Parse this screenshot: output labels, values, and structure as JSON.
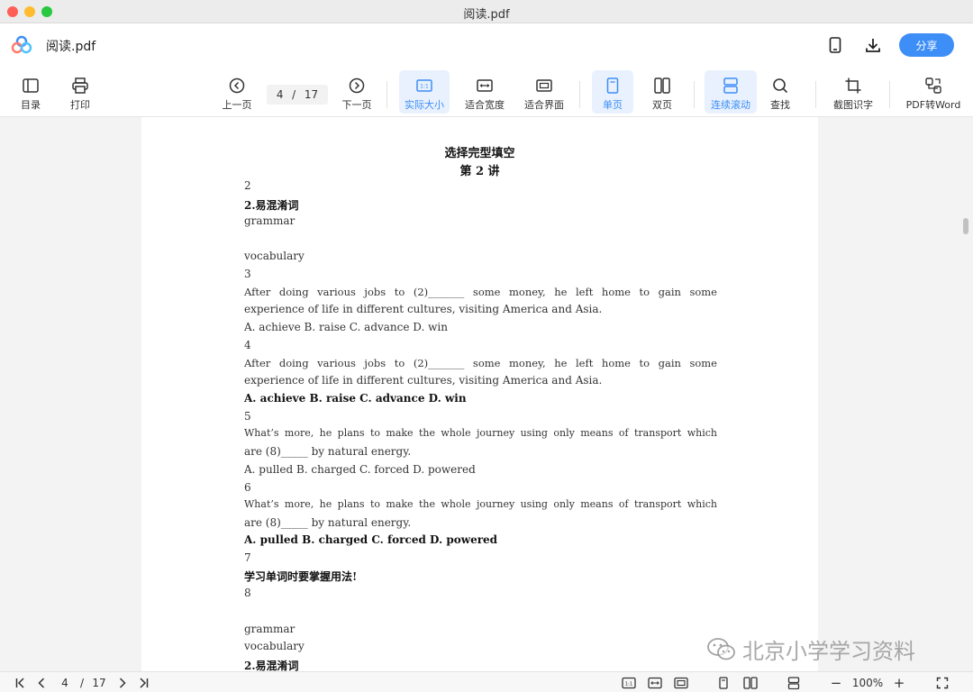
{
  "window": {
    "title": "阅读.pdf"
  },
  "header": {
    "doc_name": "阅读.pdf",
    "share_label": "分享"
  },
  "toolbar": {
    "toc": "目录",
    "print": "打印",
    "prev_page": "上一页",
    "current_page": "4",
    "page_sep": "/",
    "total_pages": "17",
    "next_page": "下一页",
    "actual_size": "实际大小",
    "fit_width": "适合宽度",
    "fit_screen": "适合界面",
    "single_page": "单页",
    "double_page": "双页",
    "continuous_scroll": "连续滚动",
    "find": "查找",
    "screenshot_ocr": "截图识字",
    "pdf_to_word": "PDF转Word"
  },
  "document": {
    "title_line1": "选择完型填空",
    "title_line2": "第 2 讲",
    "lines": [
      "2",
      "2.易混淆词",
      "grammar",
      "",
      "vocabulary",
      "3",
      "After doing various jobs to (2)_______ some money, he left home to gain some",
      "experience of life in different cultures, visiting America and Asia.",
      "A. achieve  B. raise  C. advance  D. win",
      "4",
      "After doing various jobs to (2)_______ some money, he left home to gain some",
      "experience of life in different cultures, visiting America and Asia.",
      "A. achieve  B. raise  C. advance  D. win",
      "5",
      "What’s more, he plans to make the whole journey using only means of transport which",
      "are (8)_____ by natural energy.",
      "A. pulled  B. charged   C. forced  D. powered",
      "6",
      "What’s more, he plans to make the whole journey using only means of transport which",
      "are (8)_____ by natural energy.",
      "A. pulled  B. charged   C. forced  D. powered",
      "7",
      "学习单词时要掌握用法!",
      "8",
      "",
      "grammar",
      "vocabulary",
      "2.易混淆词"
    ]
  },
  "watermark": {
    "text": "北京小学学习资料",
    "icon": "wechat-icon"
  },
  "statusbar": {
    "current_page": "4",
    "page_sep": "/",
    "total_pages": "17",
    "zoom": "100%",
    "minus": "−",
    "plus": "+"
  },
  "colors": {
    "accent": "#3d8ef7",
    "active_bg": "#e8f1fd"
  }
}
